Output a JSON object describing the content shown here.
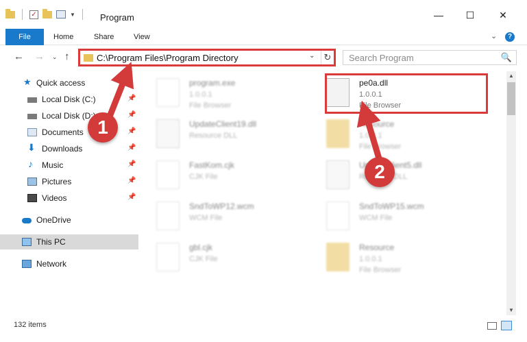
{
  "window": {
    "title": "Program",
    "minimize_glyph": "—",
    "maximize_glyph": "☐",
    "close_glyph": "✕"
  },
  "ribbon": {
    "tabs": [
      "File",
      "Home",
      "Share",
      "View"
    ],
    "collapse_glyph": "⌄",
    "help_glyph": "?"
  },
  "nav": {
    "back_glyph": "←",
    "forward_glyph": "→",
    "recent_glyph": "⌄",
    "up_glyph": "↑",
    "address": "C:\\Program Files\\Program Directory",
    "address_dropdown_glyph": "⌄",
    "refresh_glyph": "↻",
    "search_placeholder": "Search Program",
    "search_glyph": "🔍"
  },
  "sidebar": {
    "pin_glyph": "📌",
    "items": [
      {
        "label": "Quick access",
        "icon": "star-icon"
      },
      {
        "label": "Local Disk (C:)",
        "icon": "drive-icon"
      },
      {
        "label": "Local Disk (D:)",
        "icon": "drive-icon"
      },
      {
        "label": "Documents",
        "icon": "documents-icon"
      },
      {
        "label": "Downloads",
        "icon": "downloads-icon"
      },
      {
        "label": "Music",
        "icon": "music-icon"
      },
      {
        "label": "Pictures",
        "icon": "pictures-icon"
      },
      {
        "label": "Videos",
        "icon": "videos-icon"
      },
      {
        "label": "OneDrive",
        "icon": "cloud-icon"
      },
      {
        "label": "This PC",
        "icon": "pc-icon"
      },
      {
        "label": "Network",
        "icon": "network-icon"
      }
    ]
  },
  "files": [
    {
      "name": "program.exe",
      "line2": "1.0.0.1",
      "line3": "File Browser",
      "icon": "exe-icon"
    },
    {
      "name": "pe0a.dll",
      "line2": "1.0.0.1",
      "line3": "File Browser",
      "icon": "dll-gear-icon"
    },
    {
      "name": "UpdateClient19.dll",
      "line2": "Resource DLL",
      "line3": "",
      "icon": "dll-gear-icon"
    },
    {
      "name": "Resource",
      "line2": "1.0.0.1",
      "line3": "File Browser",
      "icon": "folder-icon"
    },
    {
      "name": "FastKom.cjk",
      "line2": "CJK File",
      "line3": "",
      "icon": "document-icon"
    },
    {
      "name": "UpdateClient5.dll",
      "line2": "Resource DLL",
      "line3": "",
      "icon": "dll-gear-icon"
    },
    {
      "name": "SndToWP12.wcm",
      "line2": "WCM File",
      "line3": "",
      "icon": "document-icon"
    },
    {
      "name": "SndToWP15.wcm",
      "line2": "WCM File",
      "line3": "",
      "icon": "document-icon"
    },
    {
      "name": "gbl.cjk",
      "line2": "CJK File",
      "line3": "",
      "icon": "document-icon"
    },
    {
      "name": "Resource",
      "line2": "1.0.0.1",
      "line3": "File Browser",
      "icon": "folder-icon"
    }
  ],
  "status": {
    "item_count": "132 items"
  },
  "annotations": {
    "step1": "1",
    "step2": "2"
  },
  "colors": {
    "accent": "#1979ca",
    "highlight": "#d93a3a",
    "selected": "#d9d9d9",
    "folder": "#e8c35a"
  }
}
